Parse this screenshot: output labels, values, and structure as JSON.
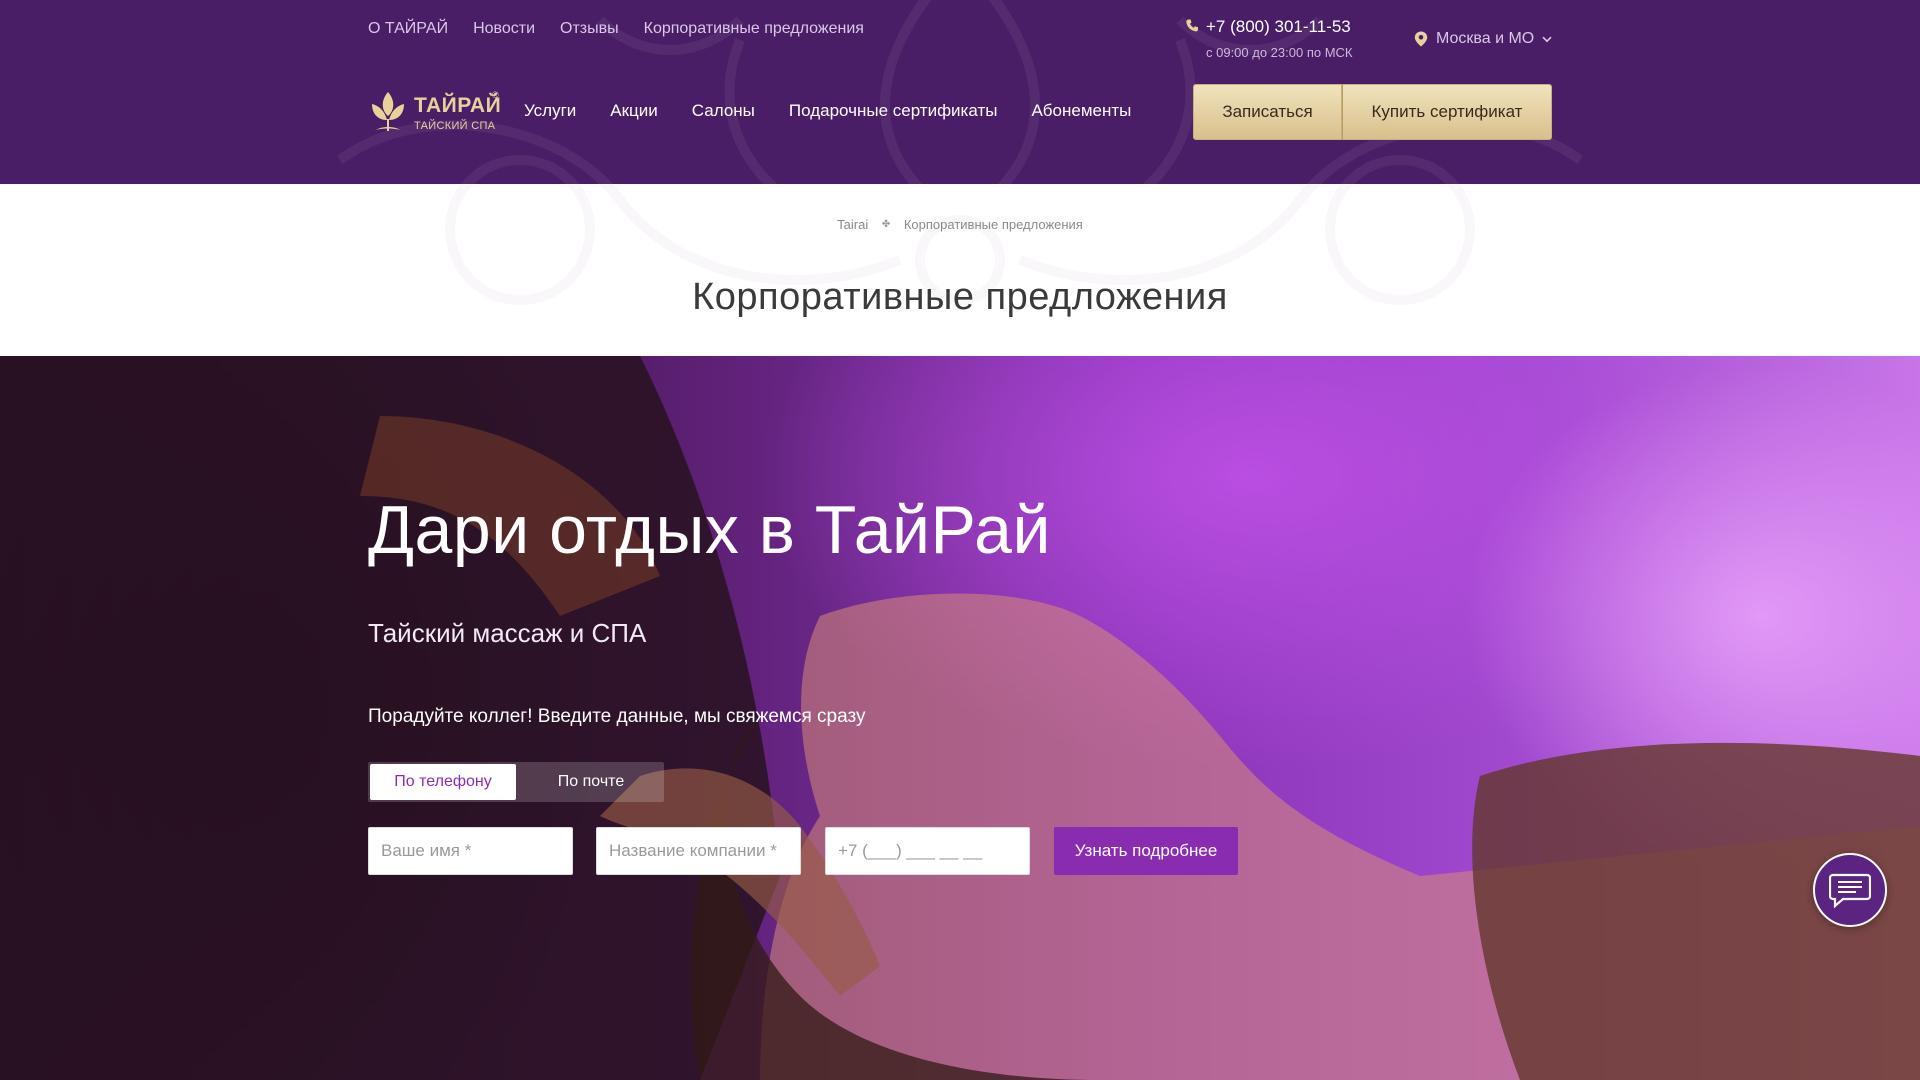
{
  "colors": {
    "header_bg": "#4a1e67",
    "accent_purple": "#8a2cb0",
    "gold_button": "#e6d3a3",
    "logo_gold": "#e8d29a"
  },
  "header": {
    "top_links": [
      "О ТАЙРАЙ",
      "Новости",
      "Отзывы",
      "Корпоративные предложения"
    ],
    "phone": "+7 (800) 301-11-53",
    "hours": "с 09:00 до 23:00 по МСК",
    "city": "Москва и МО",
    "logo_name": "ТАЙРАЙ",
    "logo_reg": "®",
    "logo_sub": "ТАЙСКИЙ СПА",
    "nav": [
      "Услуги",
      "Акции",
      "Салоны",
      "Подарочные сертификаты",
      "Абонементы"
    ],
    "book_button": "Записаться",
    "buy_cert_button": "Купить сертификат",
    "icons": {
      "phone": "phone-icon",
      "location": "location-pin-icon",
      "dropdown": "chevron-down-icon",
      "logo": "lotus-leaf-icon"
    }
  },
  "breadcrumb": {
    "home": "Tairai",
    "current": "Корпоративные предложения"
  },
  "page_title": "Корпоративные предложения",
  "hero": {
    "title": "Дари отдых в ТайРай",
    "subtitle": "Тайский массаж и СПА",
    "lead": "Порадуйте коллег! Введите данные, мы свяжемся сразу",
    "toggle": {
      "phone": "По телефону",
      "email": "По почте",
      "selected": "По телефону"
    },
    "form": {
      "name_placeholder": "Ваше имя *",
      "company_placeholder": "Название компании *",
      "phone_placeholder": "+7 (___) ___ __ __",
      "submit": "Узнать подробнее"
    }
  },
  "chat": {
    "icon": "chat-bubble-icon"
  }
}
